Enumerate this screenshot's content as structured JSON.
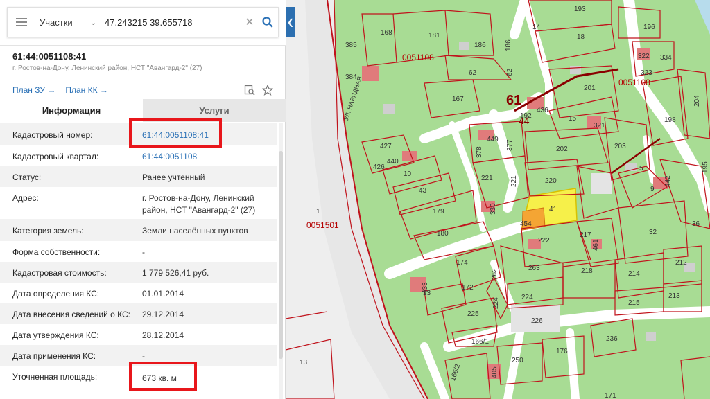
{
  "search": {
    "type_label": "Участки",
    "query": "47.243215 39.655718",
    "clear_glyph": "✕"
  },
  "object": {
    "number": "61:44:0051108:41",
    "address": "г. Ростов-на-Дону, Ленинский район, НСТ \"Авангард-2\" (27)",
    "plan_zu": "План ЗУ →",
    "plan_kk": "План КК →"
  },
  "tabs": {
    "info": "Информация",
    "services": "Услуги"
  },
  "info": [
    {
      "label": "Кадастровый номер:",
      "value": "61:44:0051108:41"
    },
    {
      "label": "Кадастровый квартал:",
      "value": "61:44:0051108"
    },
    {
      "label": "Статус:",
      "value": "Ранее учтенный"
    },
    {
      "label": "Адрес:",
      "value": "г. Ростов-на-Дону, Ленинский район, НСТ \"Авангард-2\" (27)"
    },
    {
      "label": "Категория земель:",
      "value": "Земли населённых пунктов"
    },
    {
      "label": "Форма собственности:",
      "value": "-"
    },
    {
      "label": "Кадастровая стоимость:",
      "value": "1 779 526,41 руб."
    },
    {
      "label": "Дата определения КС:",
      "value": "01.01.2014"
    },
    {
      "label": "Дата внесения сведений о КС:",
      "value": "29.12.2014"
    },
    {
      "label": "Дата утверждения КС:",
      "value": "28.12.2014"
    },
    {
      "label": "Дата применения КС:",
      "value": "-"
    },
    {
      "label": "Уточненная площадь:",
      "value": "673 кв. м"
    }
  ],
  "map": {
    "quarter_big": "61",
    "quarter_sub": "44",
    "quarter_codes": [
      "0051108",
      "0051108",
      "0051501"
    ],
    "street": "УЛ. НАРЯДНАЯ",
    "parcel_left": "1",
    "parcels": [
      "168",
      "181",
      "186",
      "186",
      "193",
      "18",
      "196",
      "14",
      "322",
      "334",
      "323",
      "385",
      "384",
      "62",
      "62",
      "201",
      "204",
      "167",
      "436",
      "192",
      "15",
      "321",
      "198",
      "449",
      "377",
      "202",
      "203",
      "427",
      "378",
      "221",
      "221",
      "220",
      "5",
      "9",
      "442",
      "195",
      "426",
      "440",
      "10",
      "43",
      "41",
      "179",
      "330",
      "217",
      "32",
      "36",
      "180",
      "222",
      "454",
      "461",
      "174",
      "263",
      "218",
      "214",
      "212",
      "433",
      "13",
      "172",
      "262",
      "224",
      "215",
      "213",
      "225",
      "224",
      "226",
      "166/1",
      "236",
      "13",
      "166/2",
      "250",
      "176",
      "405",
      "171"
    ],
    "colors": {
      "parcel_fill": "#a8dc94",
      "road": "#ffffff",
      "boundary": "#c0131c",
      "building": "#e07b7b",
      "selected": "#f6f04a",
      "selected_building": "#f4a534",
      "gray_area": "#e9e9e9"
    }
  },
  "ui_colors": {
    "accent": "#2b71b6",
    "highlight": "#e8161b"
  }
}
